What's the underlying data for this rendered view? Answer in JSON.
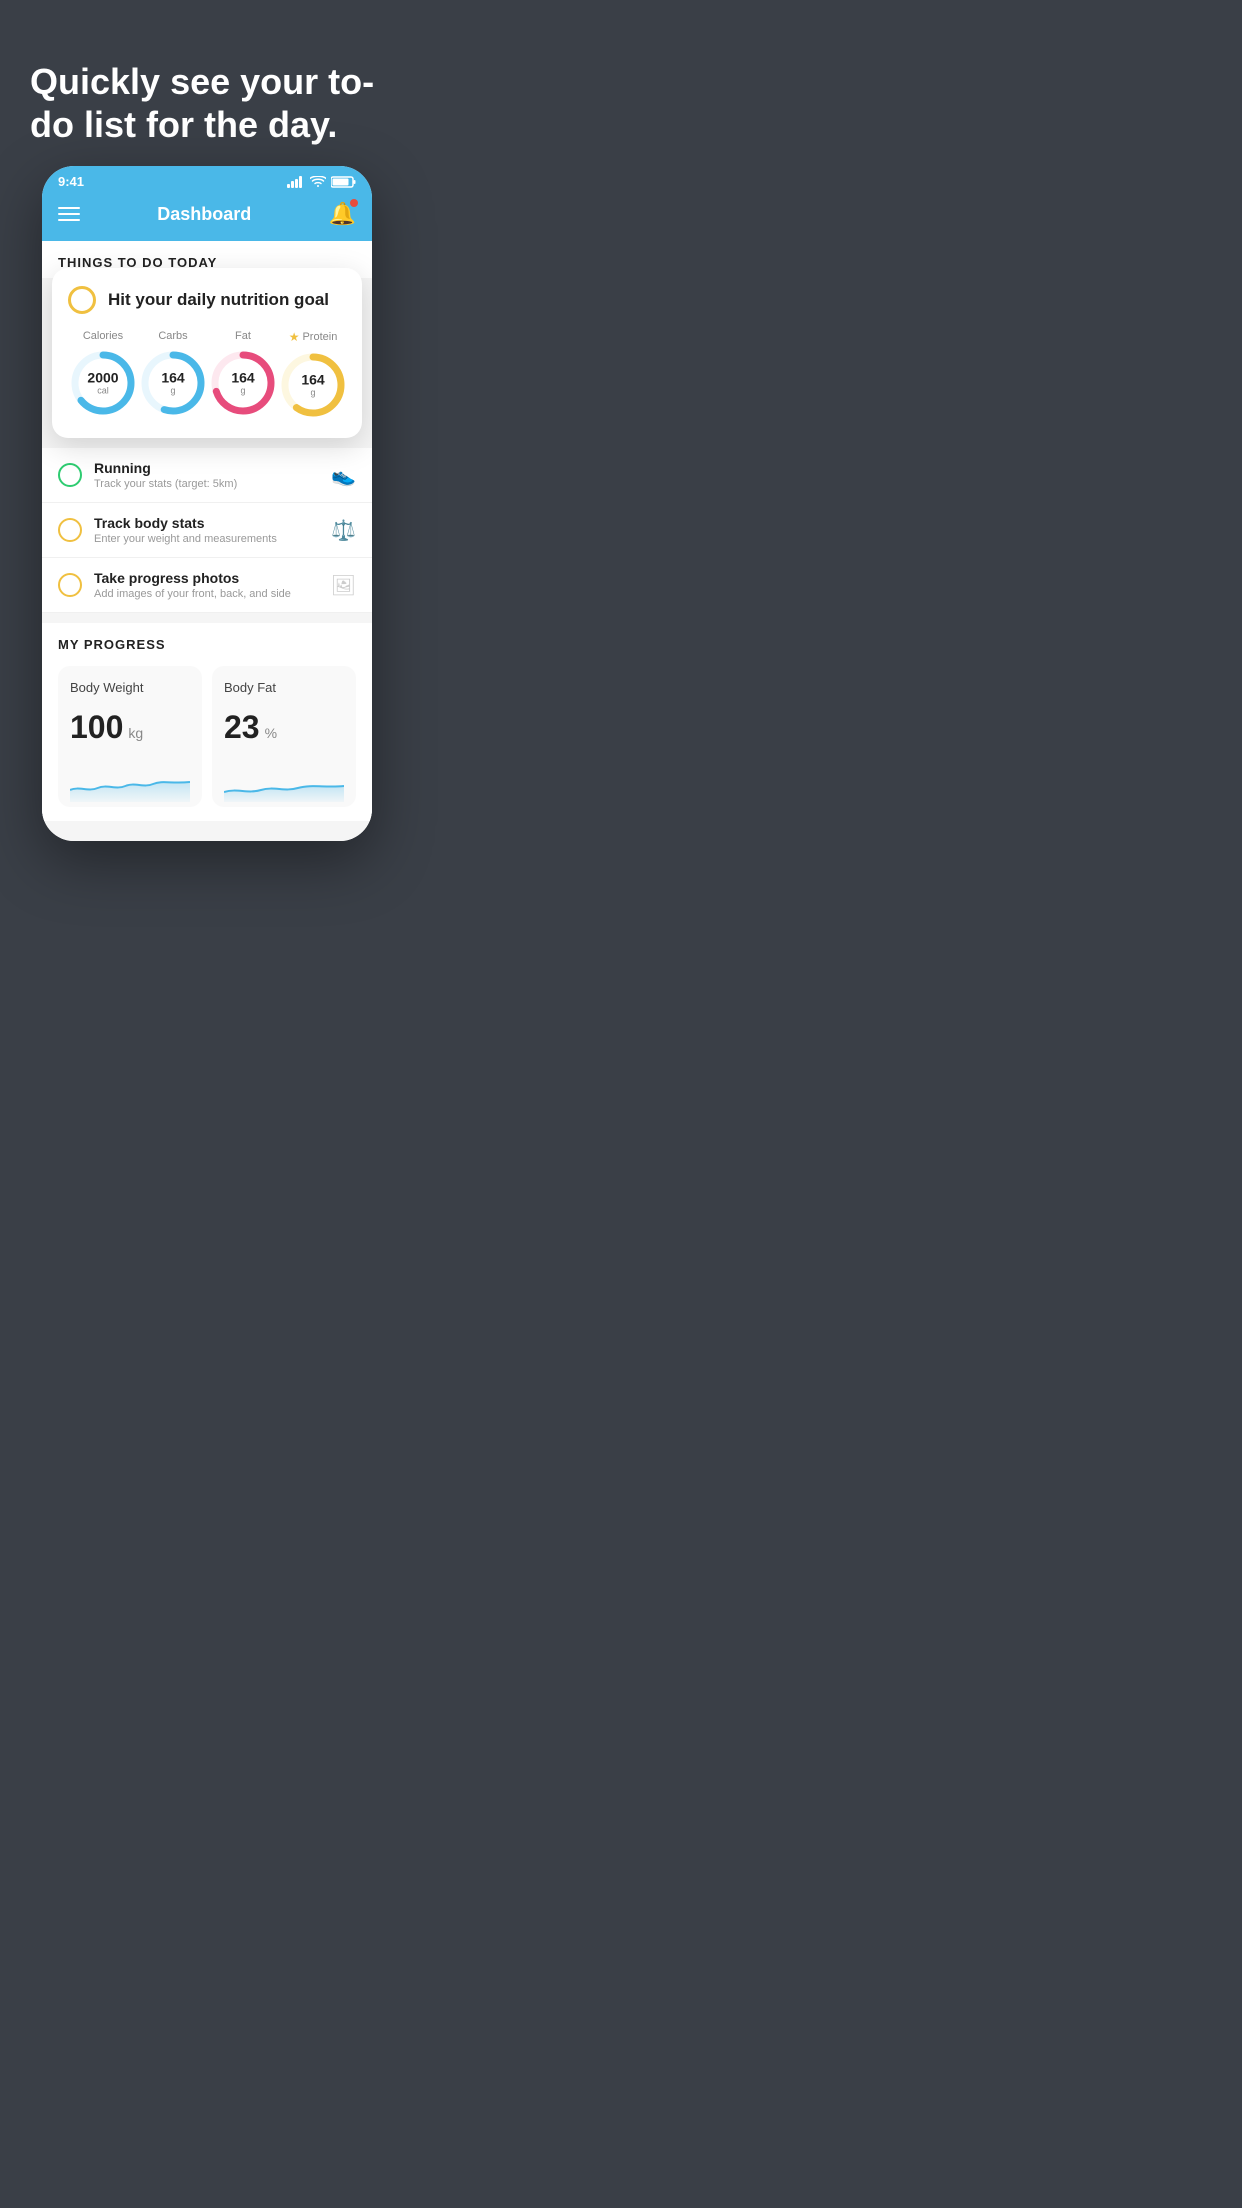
{
  "hero": {
    "title": "Quickly see your to-do list for the day."
  },
  "statusBar": {
    "time": "9:41"
  },
  "nav": {
    "title": "Dashboard"
  },
  "thingsToDo": {
    "sectionTitle": "THINGS TO DO TODAY",
    "mainCard": {
      "title": "Hit your daily nutrition goal",
      "nutrients": [
        {
          "label": "Calories",
          "value": "2000",
          "unit": "cal",
          "color": "#4ab8e8",
          "trackColor": "#e8f6fd",
          "percentage": 65,
          "star": false
        },
        {
          "label": "Carbs",
          "value": "164",
          "unit": "g",
          "color": "#4ab8e8",
          "trackColor": "#e8f6fd",
          "percentage": 55,
          "star": false
        },
        {
          "label": "Fat",
          "value": "164",
          "unit": "g",
          "color": "#e74c7c",
          "trackColor": "#fde8ef",
          "percentage": 70,
          "star": false
        },
        {
          "label": "Protein",
          "value": "164",
          "unit": "g",
          "color": "#f0c040",
          "trackColor": "#fdf7e0",
          "percentage": 60,
          "star": true
        }
      ]
    },
    "items": [
      {
        "title": "Running",
        "subtitle": "Track your stats (target: 5km)",
        "circleColor": "green",
        "icon": "shoe"
      },
      {
        "title": "Track body stats",
        "subtitle": "Enter your weight and measurements",
        "circleColor": "yellow",
        "icon": "scale"
      },
      {
        "title": "Take progress photos",
        "subtitle": "Add images of your front, back, and side",
        "circleColor": "yellow",
        "icon": "photo"
      }
    ]
  },
  "myProgress": {
    "sectionTitle": "MY PROGRESS",
    "cards": [
      {
        "title": "Body Weight",
        "value": "100",
        "unit": "kg"
      },
      {
        "title": "Body Fat",
        "value": "23",
        "unit": "%"
      }
    ]
  }
}
